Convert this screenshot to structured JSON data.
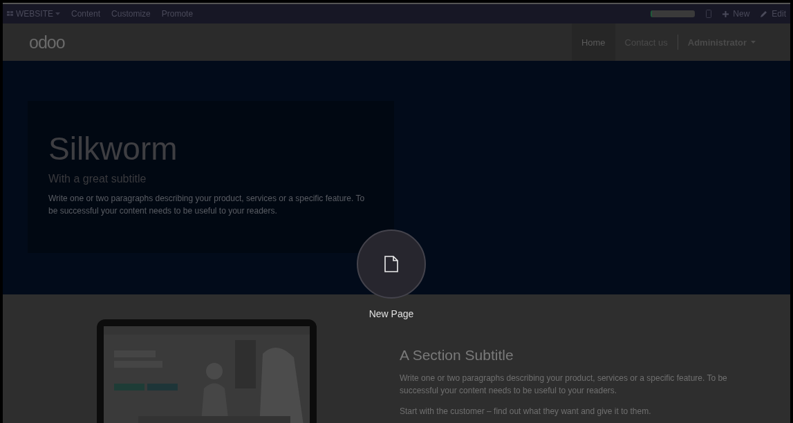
{
  "editor_bar": {
    "app_menu": "WEBSITE",
    "menus": [
      "Content",
      "Customize",
      "Promote"
    ],
    "new_button": "New",
    "edit_button": "Edit"
  },
  "navbar": {
    "logo": "odoo",
    "links": [
      {
        "label": "Home",
        "selected": true
      },
      {
        "label": "Contact us",
        "selected": false
      }
    ],
    "user_menu": "Administrator"
  },
  "hero": {
    "title": "Silkworm",
    "subtitle": "With a great subtitle",
    "text": "Write one or two paragraphs describing your product, services or a specific feature. To be successful your content needs to be useful to your readers."
  },
  "section": {
    "image": {
      "kind": "picture"
    },
    "title": "A Section Subtitle",
    "paragraphs": [
      "Write one or two paragraphs describing your product, services or a specific feature. To be successful your content needs to be useful to your readers.",
      "Start with the customer – find out what they want and give it to them."
    ]
  },
  "overlay": {
    "action": "New Page"
  }
}
